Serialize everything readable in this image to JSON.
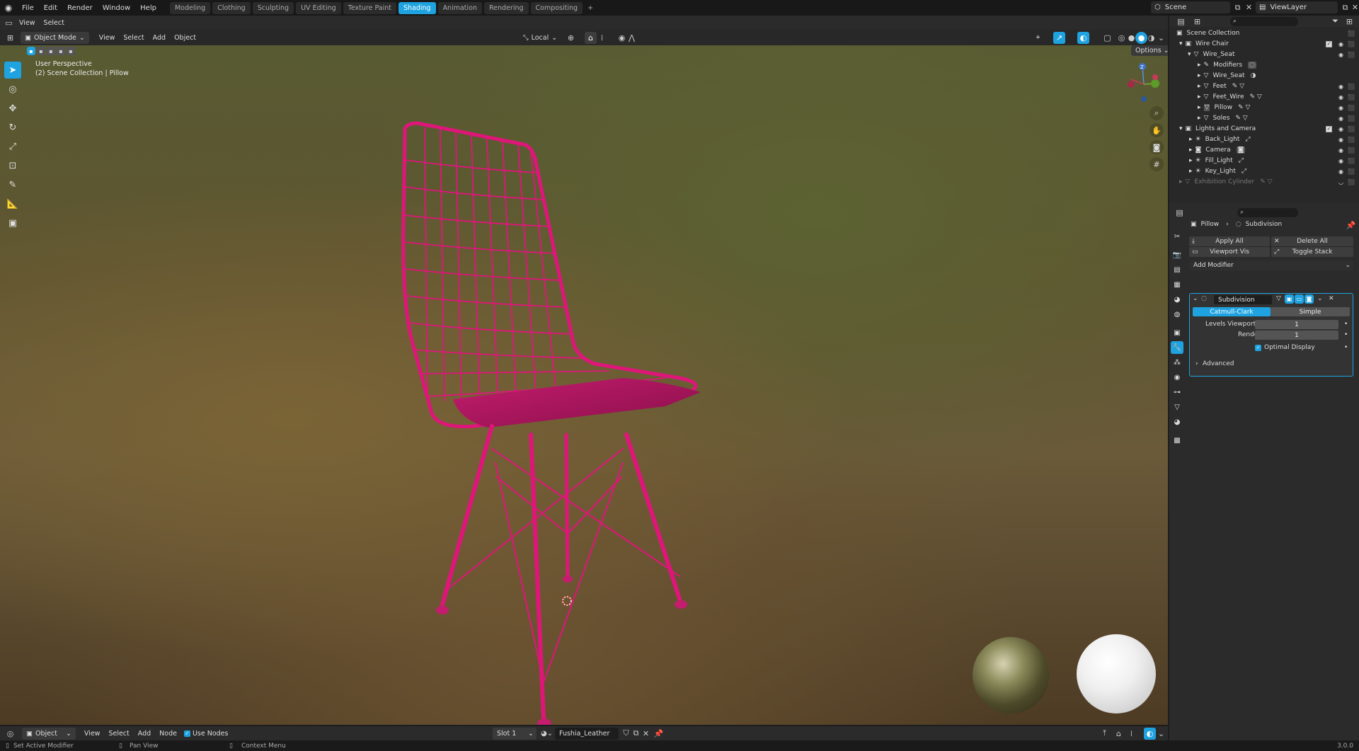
{
  "topbar": {
    "menus": [
      "File",
      "Edit",
      "Render",
      "Window",
      "Help"
    ],
    "workspaces": [
      "Modeling",
      "Clothing",
      "Sculpting",
      "UV Editing",
      "Texture Paint",
      "Shading",
      "Animation",
      "Rendering",
      "Compositing"
    ],
    "active_workspace": "Shading",
    "scene": "Scene",
    "view_layer": "ViewLayer"
  },
  "viewport_header": {
    "menus": [
      "View",
      "Select"
    ],
    "mode": "Object Mode",
    "menus2": [
      "View",
      "Select",
      "Add",
      "Object"
    ],
    "transform_orientation": "Local",
    "options": "Options"
  },
  "viewport": {
    "perspective": "User Perspective",
    "collection_info": "(2) Scene Collection | Pillow",
    "gizmo_axis": "Z",
    "accent": "#e0157a"
  },
  "outliner": {
    "rows": [
      {
        "label": "Scene Collection",
        "level": 0
      },
      {
        "label": "Wire Chair",
        "level": 1
      },
      {
        "label": "Wire_Seat",
        "level": 2
      },
      {
        "label": "Modifiers",
        "level": 3
      },
      {
        "label": "Wire_Seat",
        "level": 3
      },
      {
        "label": "Feet",
        "level": 3
      },
      {
        "label": "Feet_Wire",
        "level": 3
      },
      {
        "label": "Pillow",
        "level": 3
      },
      {
        "label": "Soles",
        "level": 3
      },
      {
        "label": "Lights and Camera",
        "level": 1
      },
      {
        "label": "Back_Light",
        "level": 2
      },
      {
        "label": "Camera",
        "level": 2
      },
      {
        "label": "Fill_Light",
        "level": 2
      },
      {
        "label": "Key_Light",
        "level": 2
      },
      {
        "label": "Exhibition Cylinder",
        "level": 1
      }
    ]
  },
  "properties": {
    "object": "Pillow",
    "modifier_breadcrumb": "Subdivision",
    "apply_all": "Apply All",
    "delete_all": "Delete All",
    "viewport_vis": "Viewport Vis",
    "toggle_stack": "Toggle Stack",
    "add_modifier": "Add Modifier",
    "modifier": {
      "name": "Subdivision",
      "type_a": "Catmull-Clark",
      "type_b": "Simple",
      "levels_viewport_label": "Levels Viewport",
      "levels_viewport": "1",
      "render_label": "Render",
      "render": "1",
      "optimal_display": "Optimal Display",
      "advanced": "Advanced"
    }
  },
  "node_header": {
    "editor": "Object",
    "menus": [
      "View",
      "Select",
      "Add",
      "Node"
    ],
    "use_nodes": "Use Nodes",
    "slot": "Slot 1",
    "material": "Fushia_Leather"
  },
  "statusbar": {
    "left": "Set Active Modifier",
    "middle": "Pan View",
    "right": "Context Menu",
    "version": "3.0.0"
  }
}
